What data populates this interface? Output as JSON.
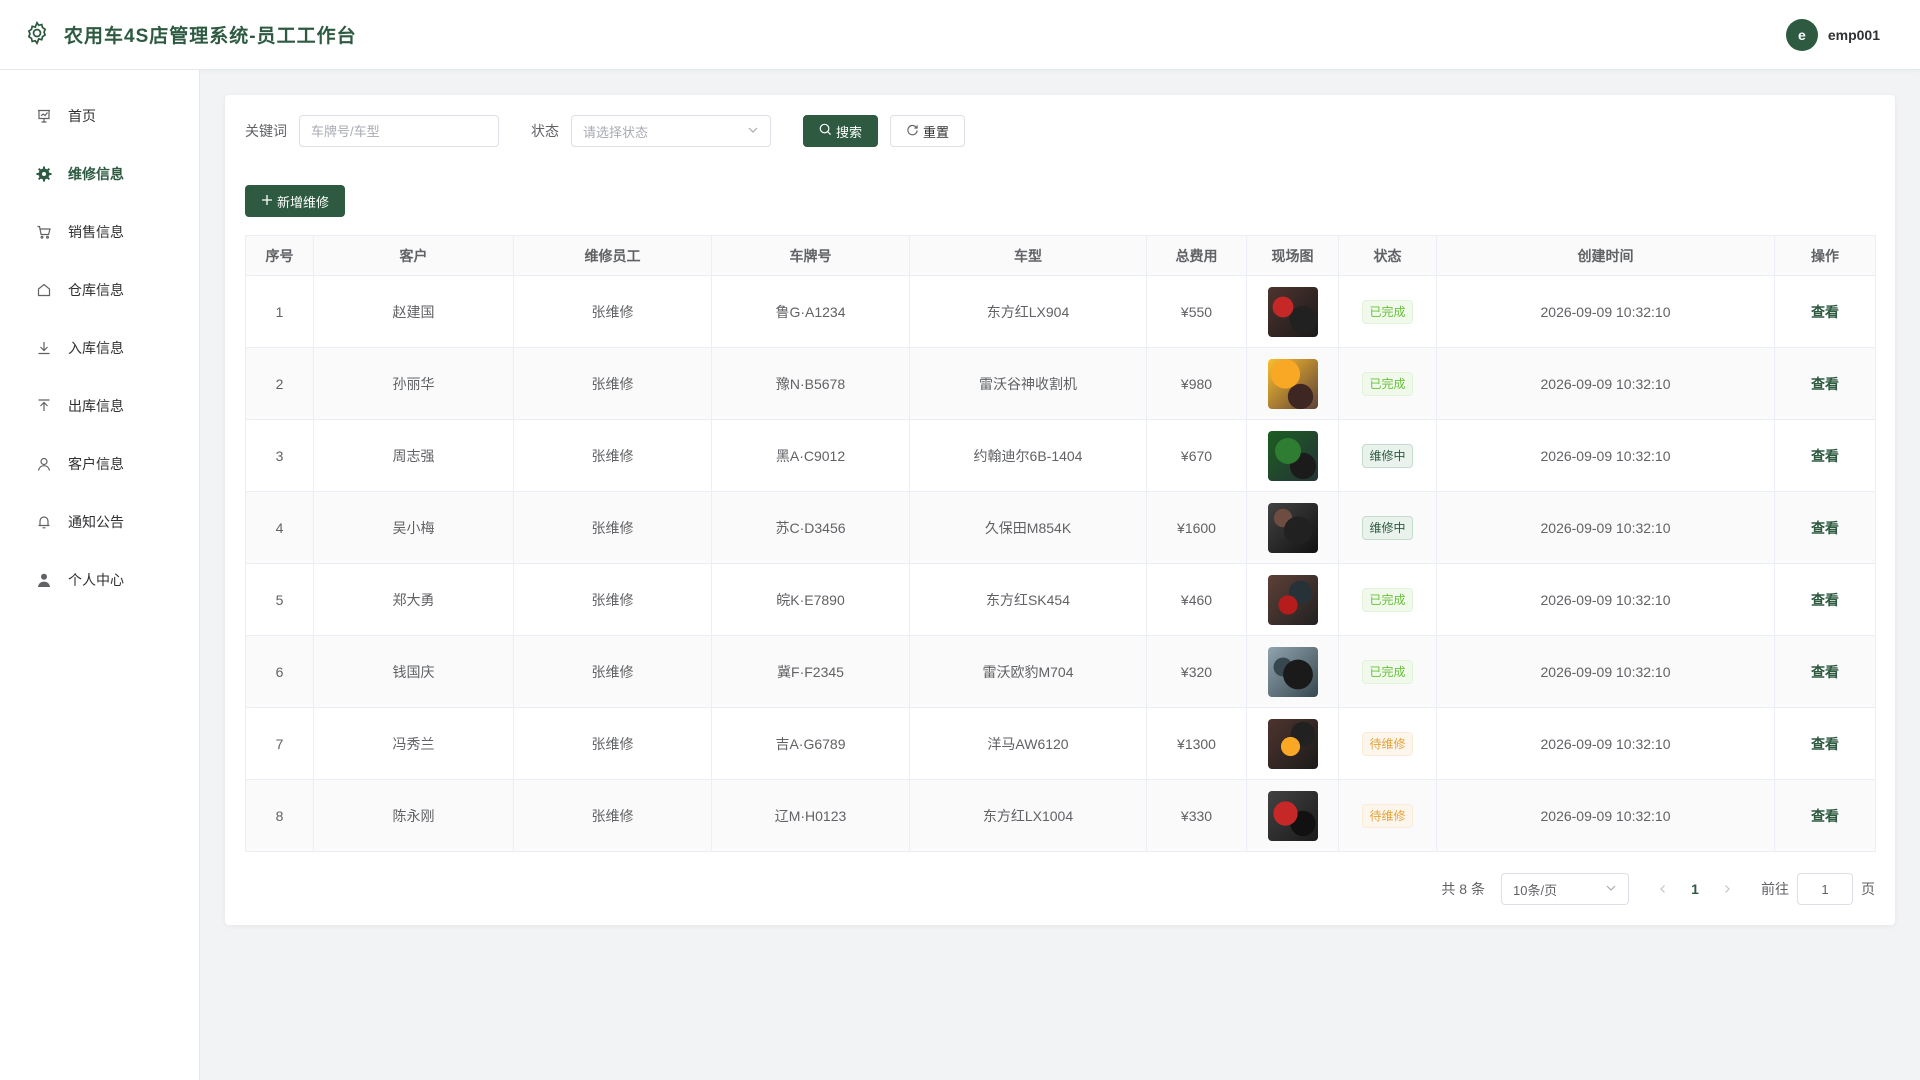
{
  "app": {
    "title": "农用车4S店管理系统-员工工作台",
    "user_initial": "e",
    "username": "emp001",
    "accent": "#2d5a40"
  },
  "sidebar": {
    "items": [
      {
        "label": "首页",
        "icon": "dashboard-icon",
        "active": false
      },
      {
        "label": "维修信息",
        "icon": "gear-icon",
        "active": true
      },
      {
        "label": "销售信息",
        "icon": "cart-icon",
        "active": false
      },
      {
        "label": "仓库信息",
        "icon": "house-icon",
        "active": false
      },
      {
        "label": "入库信息",
        "icon": "download-icon",
        "active": false
      },
      {
        "label": "出库信息",
        "icon": "upload-icon",
        "active": false
      },
      {
        "label": "客户信息",
        "icon": "user-icon",
        "active": false
      },
      {
        "label": "通知公告",
        "icon": "bell-icon",
        "active": false
      },
      {
        "label": "个人中心",
        "icon": "person-icon",
        "active": false
      }
    ]
  },
  "filters": {
    "keyword_label": "关键词",
    "keyword_placeholder": "车牌号/车型",
    "status_label": "状态",
    "status_placeholder": "请选择状态",
    "search_label": "搜索",
    "reset_label": "重置"
  },
  "add_button_label": "新增维修",
  "table": {
    "headers": [
      "序号",
      "客户",
      "维修员工",
      "车牌号",
      "车型",
      "总费用",
      "现场图",
      "状态",
      "创建时间",
      "操作"
    ],
    "rows": [
      {
        "no": "1",
        "customer": "赵建国",
        "staff": "张维修",
        "plate": "鲁G·A1234",
        "model": "东方红LX904",
        "cost": "¥550",
        "status": "已完成",
        "status_type": "done",
        "created": "2026-09-09 10:32:10",
        "action": "查看"
      },
      {
        "no": "2",
        "customer": "孙丽华",
        "staff": "张维修",
        "plate": "豫N·B5678",
        "model": "雷沃谷神收割机",
        "cost": "¥980",
        "status": "已完成",
        "status_type": "done",
        "created": "2026-09-09 10:32:10",
        "action": "查看"
      },
      {
        "no": "3",
        "customer": "周志强",
        "staff": "张维修",
        "plate": "黑A·C9012",
        "model": "约翰迪尔6B-1404",
        "cost": "¥670",
        "status": "维修中",
        "status_type": "repairing",
        "created": "2026-09-09 10:32:10",
        "action": "查看"
      },
      {
        "no": "4",
        "customer": "吴小梅",
        "staff": "张维修",
        "plate": "苏C·D3456",
        "model": "久保田M854K",
        "cost": "¥1600",
        "status": "维修中",
        "status_type": "repairing",
        "created": "2026-09-09 10:32:10",
        "action": "查看"
      },
      {
        "no": "5",
        "customer": "郑大勇",
        "staff": "张维修",
        "plate": "皖K·E7890",
        "model": "东方红SK454",
        "cost": "¥460",
        "status": "已完成",
        "status_type": "done",
        "created": "2026-09-09 10:32:10",
        "action": "查看"
      },
      {
        "no": "6",
        "customer": "钱国庆",
        "staff": "张维修",
        "plate": "冀F·F2345",
        "model": "雷沃欧豹M704",
        "cost": "¥320",
        "status": "已完成",
        "status_type": "done",
        "created": "2026-09-09 10:32:10",
        "action": "查看"
      },
      {
        "no": "7",
        "customer": "冯秀兰",
        "staff": "张维修",
        "plate": "吉A·G6789",
        "model": "洋马AW6120",
        "cost": "¥1300",
        "status": "待维修",
        "status_type": "pending",
        "created": "2026-09-09 10:32:10",
        "action": "查看"
      },
      {
        "no": "8",
        "customer": "陈永刚",
        "staff": "张维修",
        "plate": "辽M·H0123",
        "model": "东方红LX1004",
        "cost": "¥330",
        "status": "待维修",
        "status_type": "pending",
        "created": "2026-09-09 10:32:10",
        "action": "查看"
      }
    ]
  },
  "pagination": {
    "total_text": "共 8 条",
    "page_size": "10条/页",
    "current_page": "1",
    "goto_label": "前往",
    "goto_value": "1",
    "page_suffix": "页"
  }
}
